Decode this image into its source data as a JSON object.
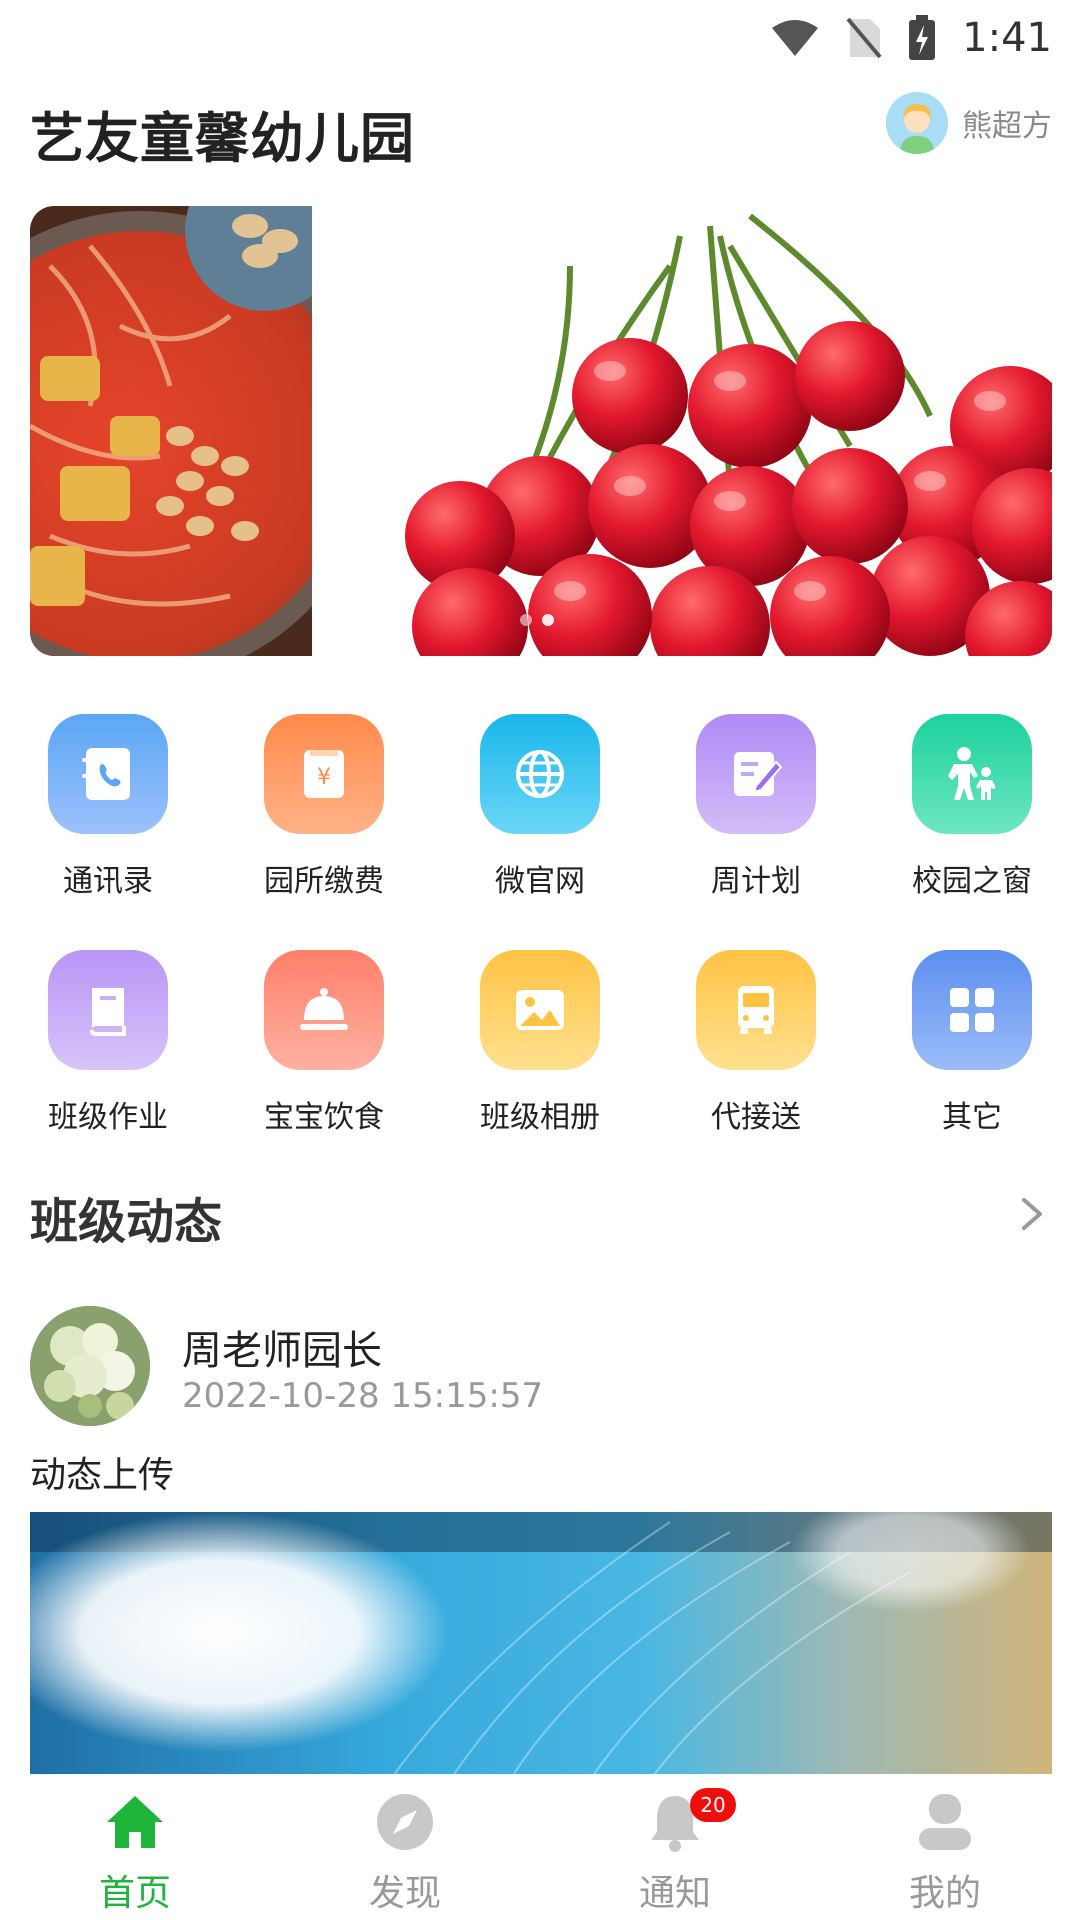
{
  "status_bar": {
    "time": "1:41"
  },
  "header": {
    "title": "艺友童馨幼儿园",
    "user_name": "熊超方"
  },
  "banner": {
    "slide_count": 2,
    "active_slide": 2
  },
  "grid": {
    "items": [
      {
        "label": "通讯录",
        "icon": "contacts-icon",
        "color_top": "#5aa7f5",
        "color_bottom": "#9cc1fb"
      },
      {
        "label": "园所缴费",
        "icon": "payment-icon",
        "color_top": "#ff8a4c",
        "color_bottom": "#ffb287"
      },
      {
        "label": "微官网",
        "icon": "globe-icon",
        "color_top": "#1ab6ea",
        "color_bottom": "#6ad6f7"
      },
      {
        "label": "周计划",
        "icon": "plan-edit-icon",
        "color_top": "#b08af5",
        "color_bottom": "#d3bcf9"
      },
      {
        "label": "校园之窗",
        "icon": "parent-child-icon",
        "color_top": "#1bd29c",
        "color_bottom": "#6ee6c1"
      },
      {
        "label": "班级作业",
        "icon": "book-icon",
        "color_top": "#b895f5",
        "color_bottom": "#d8c4fa"
      },
      {
        "label": "宝宝饮食",
        "icon": "food-cloche-icon",
        "color_top": "#ff7f6a",
        "color_bottom": "#ffb1a2"
      },
      {
        "label": "班级相册",
        "icon": "photo-icon",
        "color_top": "#ffc343",
        "color_bottom": "#ffe08f"
      },
      {
        "label": "代接送",
        "icon": "bus-icon",
        "color_top": "#ffc343",
        "color_bottom": "#ffe08f"
      },
      {
        "label": "其它",
        "icon": "apps-grid-icon",
        "color_top": "#5c8ff0",
        "color_bottom": "#9bbcf7"
      }
    ]
  },
  "section": {
    "title": "班级动态"
  },
  "post": {
    "author": "周老师园长",
    "time": "2022-10-28 15:15:57",
    "text": "动态上传"
  },
  "tabbar": {
    "tabs": [
      {
        "label": "首页",
        "icon": "home-icon",
        "active": true
      },
      {
        "label": "发现",
        "icon": "compass-icon",
        "active": false
      },
      {
        "label": "通知",
        "icon": "bell-icon",
        "active": false,
        "badge": "20"
      },
      {
        "label": "我的",
        "icon": "profile-icon",
        "active": false
      }
    ]
  },
  "colors": {
    "accent": "#1fb53a",
    "badge": "#f20d0d"
  }
}
